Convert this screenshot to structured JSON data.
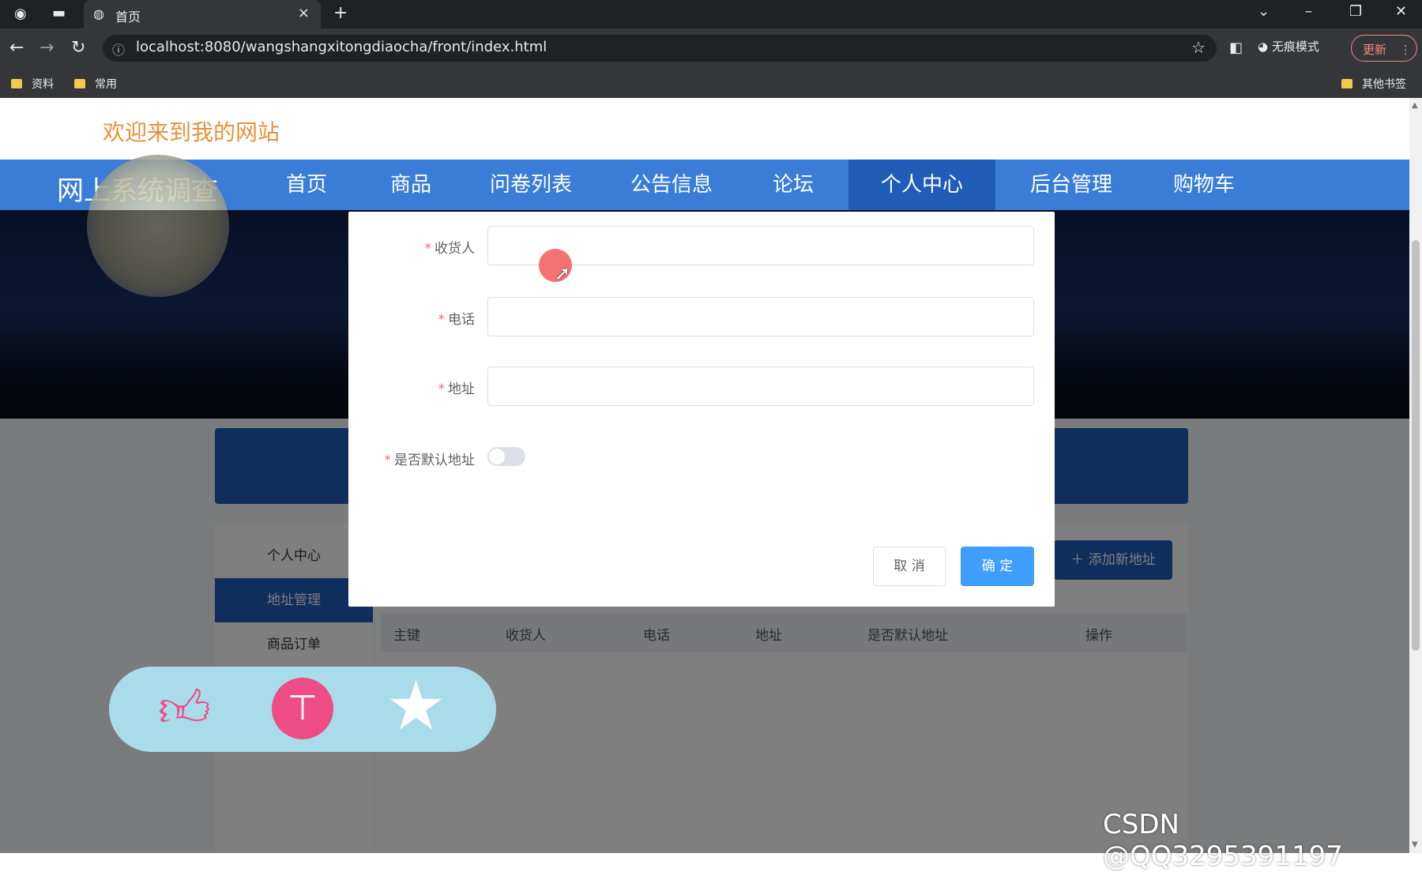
{
  "browser": {
    "tab_title": "首页",
    "tab_close": "×",
    "new_tab": "+",
    "url": "localhost:8080/wangshangxitongdiaocha/front/index.html",
    "incognito_label": "无痕模式",
    "update_label": "更新",
    "bookmarks": [
      "资料",
      "常用"
    ],
    "other_bookmarks": "其他书签"
  },
  "site": {
    "welcome": "欢迎来到我的网站",
    "brand": "网上系统调查",
    "nav": [
      "首页",
      "商品",
      "问卷列表",
      "公告信息",
      "论坛",
      "个人中心",
      "后台管理",
      "购物车"
    ],
    "active_nav": "个人中心"
  },
  "sidebar": {
    "items": [
      "个人中心",
      "地址管理",
      "商品订单"
    ]
  },
  "address_page": {
    "add_button": "添加新地址",
    "table_headers": [
      "主键",
      "收货人",
      "电话",
      "地址",
      "是否默认地址",
      "操作"
    ]
  },
  "modal": {
    "fields": [
      {
        "label": "收货人",
        "value": ""
      },
      {
        "label": "电话",
        "value": ""
      },
      {
        "label": "地址",
        "value": ""
      }
    ],
    "default_label": "是否默认地址",
    "default_on": false,
    "cancel": "取 消",
    "confirm": "确 定"
  },
  "floating": {
    "like_icon": "thumbs-up-icon",
    "top_icon": "back-to-top-icon",
    "star_icon": "favorite-star-icon",
    "top_glyph": "⊤"
  },
  "watermark": "CSDN @QQ3295391197",
  "colors": {
    "nav_blue": "#3a7dd8",
    "active_blue": "#1f5db8",
    "confirm_blue": "#409eff",
    "welcome_orange": "#e8913a",
    "pink": "#ee4c84"
  }
}
